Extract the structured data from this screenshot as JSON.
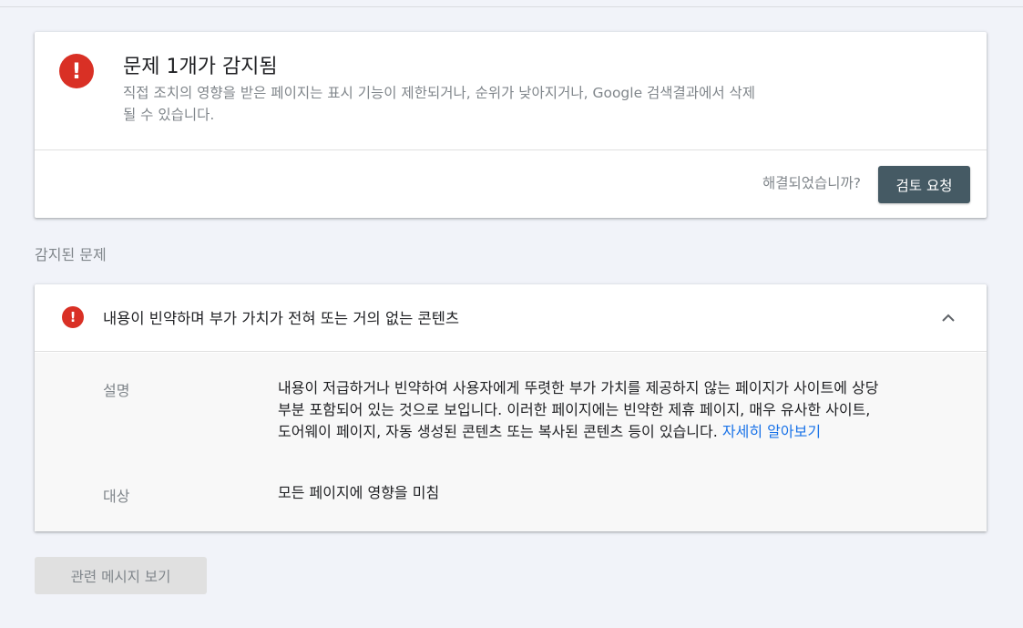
{
  "summary": {
    "title": "문제 1개가 감지됨",
    "description": "직접 조치의 영향을 받은 페이지는 표시 기능이 제한되거나, 순위가 낮아지거나, Google 검색결과에서 삭제될 수 있습니다.",
    "resolved_question": "해결되었습니까?",
    "review_button": "검토 요청",
    "icon": "alert-icon",
    "icon_glyph": "!"
  },
  "section_label": "감지된 문제",
  "issue": {
    "title": "내용이 빈약하며 부가 가치가 전혀 또는 거의 없는 콘텐츠",
    "icon": "alert-icon",
    "icon_glyph": "!",
    "expanded": true,
    "description_label": "설명",
    "description_text": "내용이 저급하거나 빈약하여 사용자에게 뚜렷한 부가 가치를 제공하지 않는 페이지가 사이트에 상당 부분 포함되어 있는 것으로 보입니다. 이러한 페이지에는 빈약한 제휴 페이지, 매우 유사한 사이트, 도어웨이 페이지, 자동 생성된 콘텐츠 또는 복사된 콘텐츠 등이 있습니다. ",
    "learn_more": "자세히 알아보기",
    "target_label": "대상",
    "target_value": "모든 페이지에 영향을 미침"
  },
  "related_button": "관련 메시지 보기",
  "colors": {
    "alert": "#d93025",
    "primary_button": "#455a64",
    "link": "#1a73e8",
    "background": "#f1f3f9"
  }
}
